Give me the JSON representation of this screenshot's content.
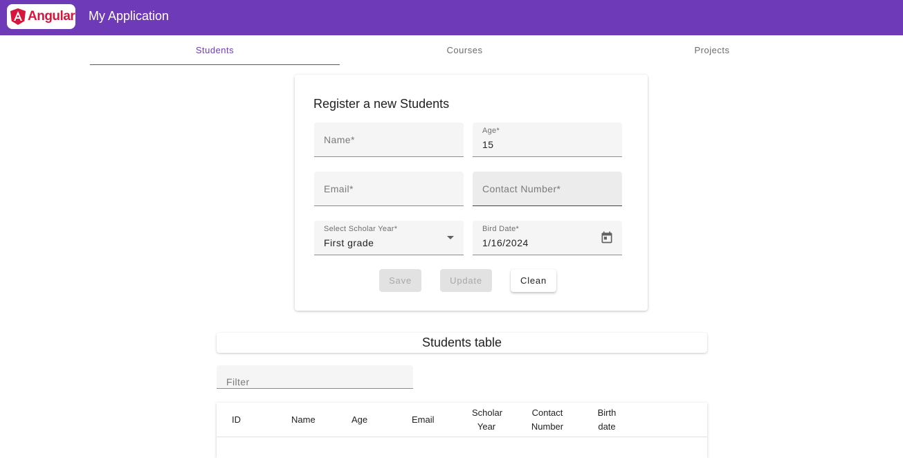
{
  "app": {
    "brand": "Angular",
    "title": "My Application",
    "brand_color": "#6f3ab7",
    "logo_color": "#d6163d"
  },
  "tabs": [
    {
      "label": "Students",
      "active": true
    },
    {
      "label": "Courses",
      "active": false
    },
    {
      "label": "Projects",
      "active": false
    }
  ],
  "form": {
    "title": "Register a new Students",
    "name": {
      "placeholder": "Name*",
      "value": ""
    },
    "age": {
      "label": "Age*",
      "value": "15"
    },
    "email": {
      "placeholder": "Email*",
      "value": ""
    },
    "contact": {
      "placeholder": "Contact Number*",
      "value": ""
    },
    "scholar_year": {
      "label": "Select Scholar Year*",
      "value": "First grade",
      "icon": "dropdown-arrow-icon"
    },
    "birth_date": {
      "label": "Bird Date*",
      "value": "1/16/2024",
      "icon": "calendar-icon"
    },
    "buttons": {
      "save": "Save",
      "update": "Update",
      "clean": "Clean"
    }
  },
  "table": {
    "title": "Students table",
    "filter_placeholder": "Filter",
    "columns": [
      {
        "line1": "ID",
        "line2": ""
      },
      {
        "line1": "Name",
        "line2": ""
      },
      {
        "line1": "Age",
        "line2": ""
      },
      {
        "line1": "Email",
        "line2": ""
      },
      {
        "line1": "Scholar",
        "line2": "Year"
      },
      {
        "line1": "Contact",
        "line2": "Number"
      },
      {
        "line1": "Birth",
        "line2": "date"
      }
    ]
  }
}
